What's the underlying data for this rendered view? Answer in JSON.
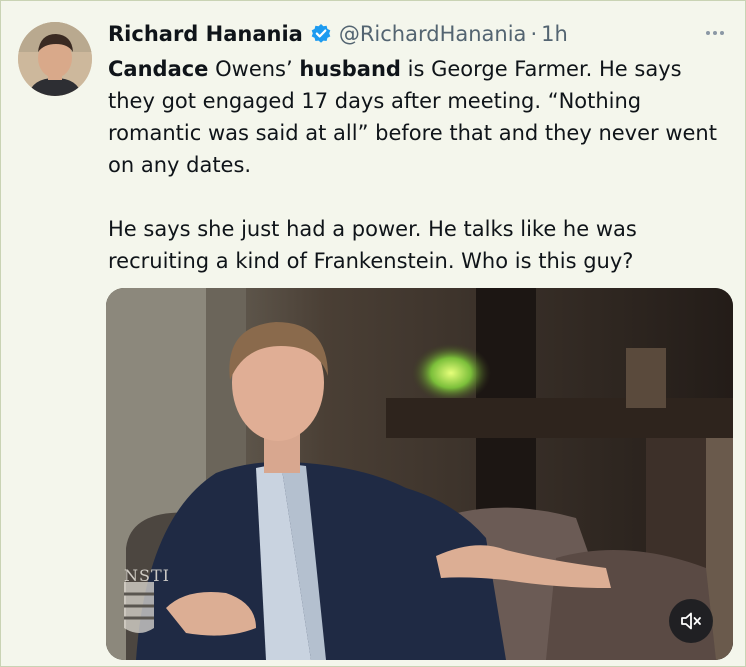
{
  "post": {
    "author_name": "Richard Hanania",
    "author_handle": "@RichardHanania",
    "separator": "·",
    "timestamp": "1h",
    "line1_bold_a": "Candace",
    "line1_plain_a": " Owens’ ",
    "line1_bold_b": "husband",
    "line1_plain_b": " is George Farmer. He says they got engaged 17 days after meeting. “Nothing romantic was said at all” before that and they never went on any dates.",
    "paragraph2": "He says she just had a power. He talks like he was recruiting a kind of Frankenstein. Who is this guy?"
  },
  "media": {
    "watermark_text": "NSTI",
    "mute_icon": "speaker-muted-icon"
  },
  "icons": {
    "verified": "verified-badge-icon",
    "more": "more-options-icon"
  },
  "colors": {
    "verified_blue": "#1d9bf0",
    "secondary_text": "#536471",
    "primary_text": "#0f1419"
  }
}
